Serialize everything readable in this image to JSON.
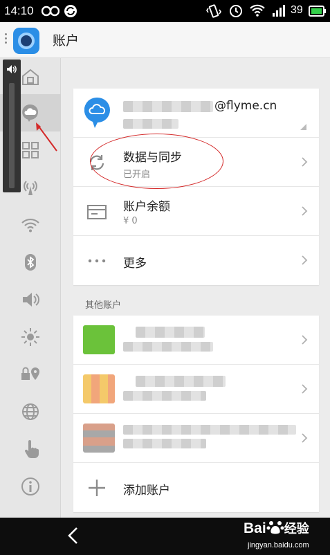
{
  "status_bar": {
    "time": "14:10",
    "battery_level": "39",
    "icons": [
      "infinity-icon",
      "sync-badge-icon",
      "vibrate-icon",
      "alarm-icon",
      "wifi-icon",
      "signal-3g-icon",
      "battery-icon"
    ]
  },
  "app_bar": {
    "title": "账户",
    "logo_icon": "flyme-logo-icon"
  },
  "sidebar": {
    "items": [
      {
        "icon": "home-icon",
        "active": false
      },
      {
        "icon": "cloud-account-icon",
        "active": true
      },
      {
        "icon": "grid-icon",
        "active": false
      },
      {
        "icon": "hotspot-icon",
        "active": false
      },
      {
        "icon": "wifi-icon",
        "active": false
      },
      {
        "icon": "bluetooth-icon",
        "active": false
      },
      {
        "icon": "sound-icon",
        "active": false
      },
      {
        "icon": "brightness-icon",
        "active": false
      },
      {
        "icon": "lock-location-icon",
        "active": false
      },
      {
        "icon": "globe-icon",
        "active": false
      },
      {
        "icon": "hand-touch-icon",
        "active": false
      },
      {
        "icon": "info-icon",
        "active": false
      }
    ]
  },
  "volume_overlay": {
    "icon": "speaker-icon"
  },
  "main": {
    "flyme_account": {
      "email_suffix": "@flyme.cn",
      "icon": "cloud-badge-icon"
    },
    "account_rows": [
      {
        "title": "数据与同步",
        "subtitle": "已开启",
        "icon": "sync-icon"
      },
      {
        "title": "账户余额",
        "subtitle": "¥ 0",
        "icon": "wallet-icon"
      },
      {
        "title": "更多",
        "subtitle": "",
        "icon": "more-dots-icon"
      }
    ],
    "other_accounts_label": "其他账户",
    "add_account_label": "添加账户"
  },
  "navbar": {
    "back_icon": "back-chevron-icon",
    "watermark_brand": "Bai",
    "watermark_zh": "经验",
    "watermark_url": "jingyan.baidu.com"
  },
  "colors": {
    "accent_blue": "#2b8ee6",
    "annotation_red": "#d42a2a",
    "status_bar_bg": "#000000"
  }
}
